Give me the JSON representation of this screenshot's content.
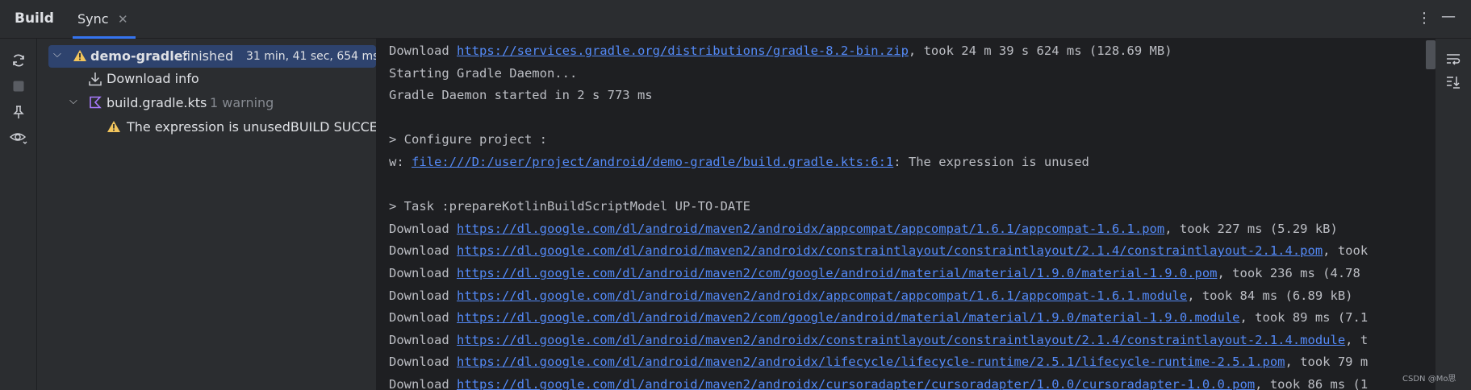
{
  "tabs": {
    "build": "Build",
    "sync": "Sync",
    "sync_close": "✕"
  },
  "topbar": {
    "more_icon": "⋮",
    "minimize_icon": "—"
  },
  "tree": {
    "root": {
      "name": "demo-gradle:",
      "status": "finished",
      "time": "31 min, 41 sec, 654 ms"
    },
    "download_info": "Download info",
    "build_file": {
      "name": "build.gradle.kts",
      "warning_count": "1 warning"
    },
    "warning_message": "The expression is unusedBUILD SUCCESSFUL"
  },
  "console": {
    "lines": [
      {
        "prefix": "Download ",
        "link": "https://services.gradle.org/distributions/gradle-8.2-bin.zip",
        "suffix": ", took 24 m 39 s 624 ms (128.69 MB)"
      },
      {
        "text": "Starting Gradle Daemon..."
      },
      {
        "text": "Gradle Daemon started in 2 s 773 ms"
      },
      {
        "text": ""
      },
      {
        "text": "> Configure project :"
      },
      {
        "prefix": "w: ",
        "link": "file:///D:/user/project/android/demo-gradle/build.gradle.kts:6:1",
        "suffix": ": The expression is unused"
      },
      {
        "text": ""
      },
      {
        "text": "> Task :prepareKotlinBuildScriptModel UP-TO-DATE"
      },
      {
        "prefix": "Download ",
        "link": "https://dl.google.com/dl/android/maven2/androidx/appcompat/appcompat/1.6.1/appcompat-1.6.1.pom",
        "suffix": ", took 227 ms (5.29 kB)"
      },
      {
        "prefix": "Download ",
        "link": "https://dl.google.com/dl/android/maven2/androidx/constraintlayout/constraintlayout/2.1.4/constraintlayout-2.1.4.pom",
        "suffix": ", took"
      },
      {
        "prefix": "Download ",
        "link": "https://dl.google.com/dl/android/maven2/com/google/android/material/material/1.9.0/material-1.9.0.pom",
        "suffix": ", took 236 ms (4.78"
      },
      {
        "prefix": "Download ",
        "link": "https://dl.google.com/dl/android/maven2/androidx/appcompat/appcompat/1.6.1/appcompat-1.6.1.module",
        "suffix": ", took 84 ms (6.89 kB)"
      },
      {
        "prefix": "Download ",
        "link": "https://dl.google.com/dl/android/maven2/com/google/android/material/material/1.9.0/material-1.9.0.module",
        "suffix": ", took 89 ms (7.1"
      },
      {
        "prefix": "Download ",
        "link": "https://dl.google.com/dl/android/maven2/androidx/constraintlayout/constraintlayout/2.1.4/constraintlayout-2.1.4.module",
        "suffix": ", t"
      },
      {
        "prefix": "Download ",
        "link": "https://dl.google.com/dl/android/maven2/androidx/lifecycle/lifecycle-runtime/2.5.1/lifecycle-runtime-2.5.1.pom",
        "suffix": ", took 79 m"
      },
      {
        "prefix": "Download ",
        "link": "https://dl.google.com/dl/android/maven2/androidx/cursoradapter/cursoradapter/1.0.0/cursoradapter-1.0.0.pom",
        "suffix": ", took 86 ms (1"
      }
    ]
  },
  "watermark": "CSDN @Mo思",
  "colors": {
    "accent": "#3574f0",
    "link": "#548af7",
    "warning": "#f2c55c",
    "selection": "#2e436e"
  },
  "icons": {
    "left_toolbar": [
      "sync-icon",
      "stop-icon",
      "pin-icon",
      "eye-icon"
    ],
    "right_toolbar": [
      "soft-wrap-icon",
      "scroll-to-end-icon"
    ],
    "tree": [
      "warning-icon",
      "download-icon",
      "kotlin-file-icon"
    ]
  }
}
